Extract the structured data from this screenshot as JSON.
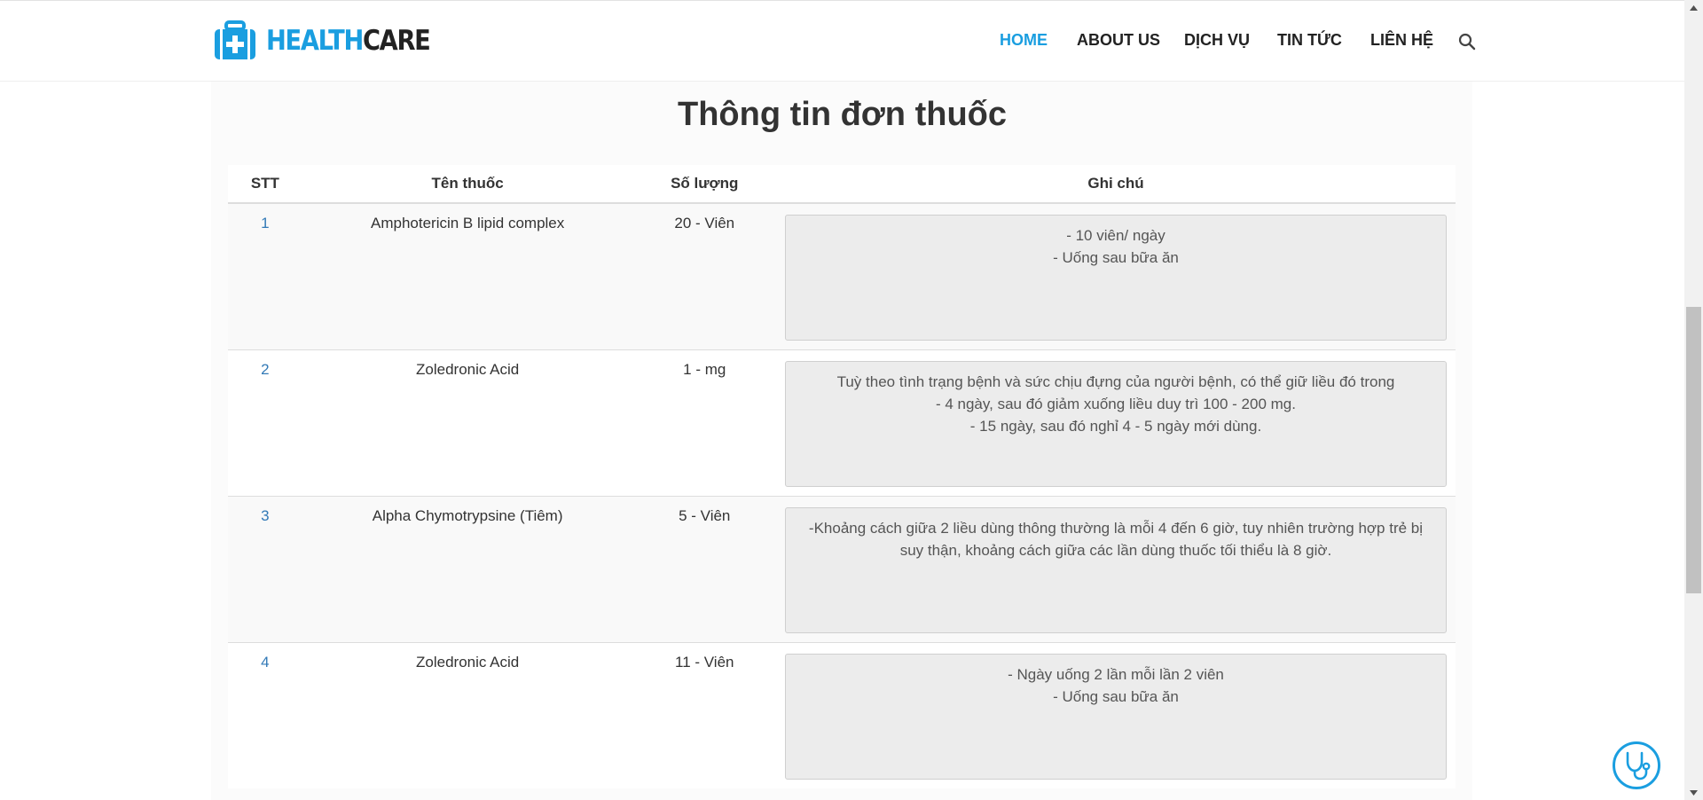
{
  "brand": {
    "part1": "HEALTH",
    "part2": "CARE"
  },
  "nav": {
    "items": [
      {
        "label": "HOME",
        "active": true
      },
      {
        "label": "ABOUT US",
        "active": false
      },
      {
        "label": "DỊCH VỤ",
        "active": false
      },
      {
        "label": "TIN TỨC",
        "active": false
      },
      {
        "label": "LIÊN HỆ",
        "active": false
      }
    ],
    "search_icon": "search-icon"
  },
  "page": {
    "title": "Thông tin đơn thuốc"
  },
  "table": {
    "headers": {
      "stt": "STT",
      "name": "Tên thuốc",
      "quantity": "Số lượng",
      "note": "Ghi chú"
    },
    "rows": [
      {
        "stt": "1",
        "name": "Amphotericin B lipid complex",
        "quantity": "20 - Viên",
        "note": "- 10 viên/ ngày\n- Uống sau bữa ăn"
      },
      {
        "stt": "2",
        "name": "Zoledronic Acid",
        "quantity": "1 - mg",
        "note": "Tuỳ theo tình trạng bệnh và sức chịu đựng của người bệnh, có thể giữ liều đó trong\n- 4 ngày, sau đó giảm xuống liều duy trì 100 - 200 mg.\n- 15 ngày, sau đó nghỉ 4 - 5 ngày mới dùng."
      },
      {
        "stt": "3",
        "name": "Alpha Chymotrypsine (Tiêm)",
        "quantity": "5 - Viên",
        "note": "-Khoảng cách giữa 2 liều dùng thông thường là mỗi 4 đến 6 giờ, tuy nhiên trường hợp trẻ bị suy thận, khoảng cách giữa các lần dùng thuốc tối thiểu là 8 giờ."
      },
      {
        "stt": "4",
        "name": "Zoledronic Acid",
        "quantity": "11 - Viên",
        "note": "- Ngày uống 2 lần mỗi lần 2 viên\n- Uống sau bữa ăn"
      }
    ]
  },
  "colors": {
    "accent": "#1a9ee0",
    "link": "#337ab7",
    "text": "#333333"
  },
  "floating_button": {
    "icon": "stethoscope-icon"
  }
}
